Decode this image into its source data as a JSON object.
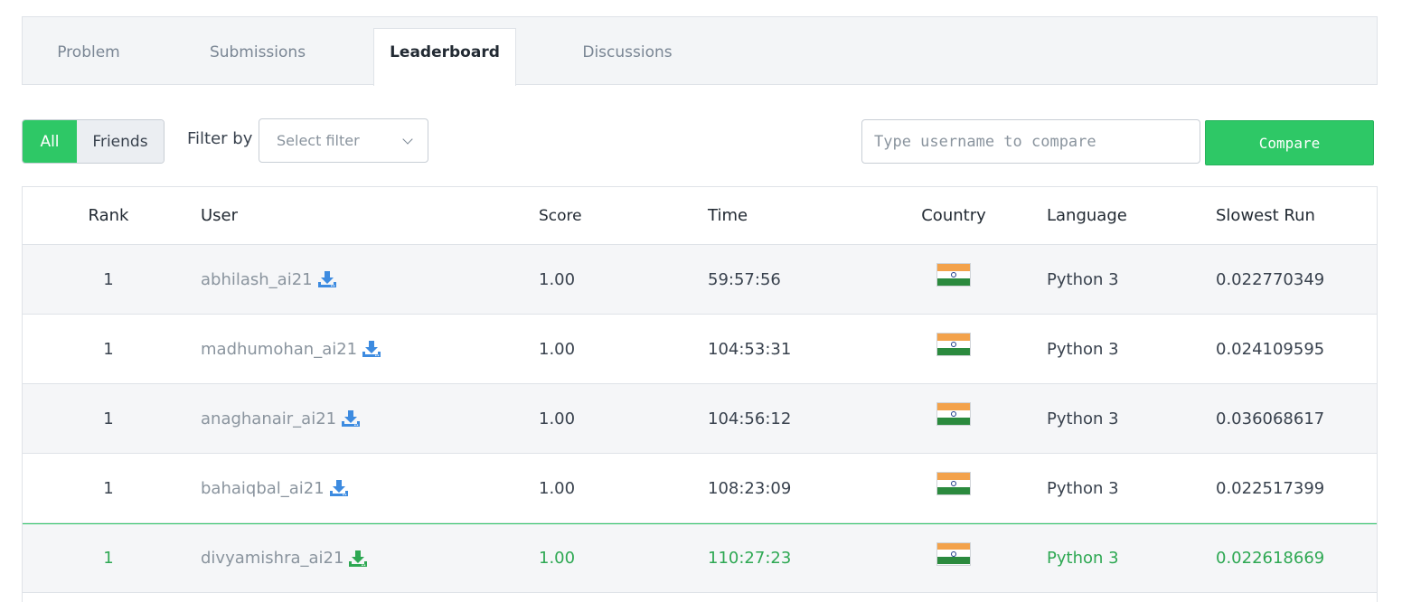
{
  "tabs": [
    {
      "label": "Problem"
    },
    {
      "label": "Submissions"
    },
    {
      "label": "Leaderboard"
    },
    {
      "label": "Discussions"
    }
  ],
  "filters": {
    "all_label": "All",
    "friends_label": "Friends",
    "filter_by_label": "Filter by",
    "select_placeholder": "Select filter"
  },
  "compare": {
    "placeholder": "Type username to compare",
    "button_label": "Compare"
  },
  "table": {
    "headers": {
      "rank": "Rank",
      "user": "User",
      "score": "Score",
      "time": "Time",
      "country": "Country",
      "language": "Language",
      "slowest_run": "Slowest Run"
    },
    "rows": [
      {
        "rank": "1",
        "user": "abhilash_ai21",
        "score": "1.00",
        "time": "59:57:56",
        "country": "India",
        "language": "Python 3",
        "slowest_run": "0.022770349"
      },
      {
        "rank": "1",
        "user": "madhumohan_ai21",
        "score": "1.00",
        "time": "104:53:31",
        "country": "India",
        "language": "Python 3",
        "slowest_run": "0.024109595"
      },
      {
        "rank": "1",
        "user": "anaghanair_ai21",
        "score": "1.00",
        "time": "104:56:12",
        "country": "India",
        "language": "Python 3",
        "slowest_run": "0.036068617"
      },
      {
        "rank": "1",
        "user": "bahaiqbal_ai21",
        "score": "1.00",
        "time": "108:23:09",
        "country": "India",
        "language": "Python 3",
        "slowest_run": "0.022517399"
      },
      {
        "rank": "1",
        "user": "divyamishra_ai21",
        "score": "1.00",
        "time": "110:27:23",
        "country": "India",
        "language": "Python 3",
        "slowest_run": "0.022618669"
      }
    ]
  },
  "colors": {
    "accent_green": "#2ec866",
    "download_blue": "#3d8be0",
    "download_green": "#2ea853",
    "flag_saffron": "#f3a24b",
    "flag_green": "#2b8a3e"
  },
  "icons": {
    "download": "download-icon",
    "chevron": "chevron-down-icon",
    "flag": "india-flag-icon"
  }
}
